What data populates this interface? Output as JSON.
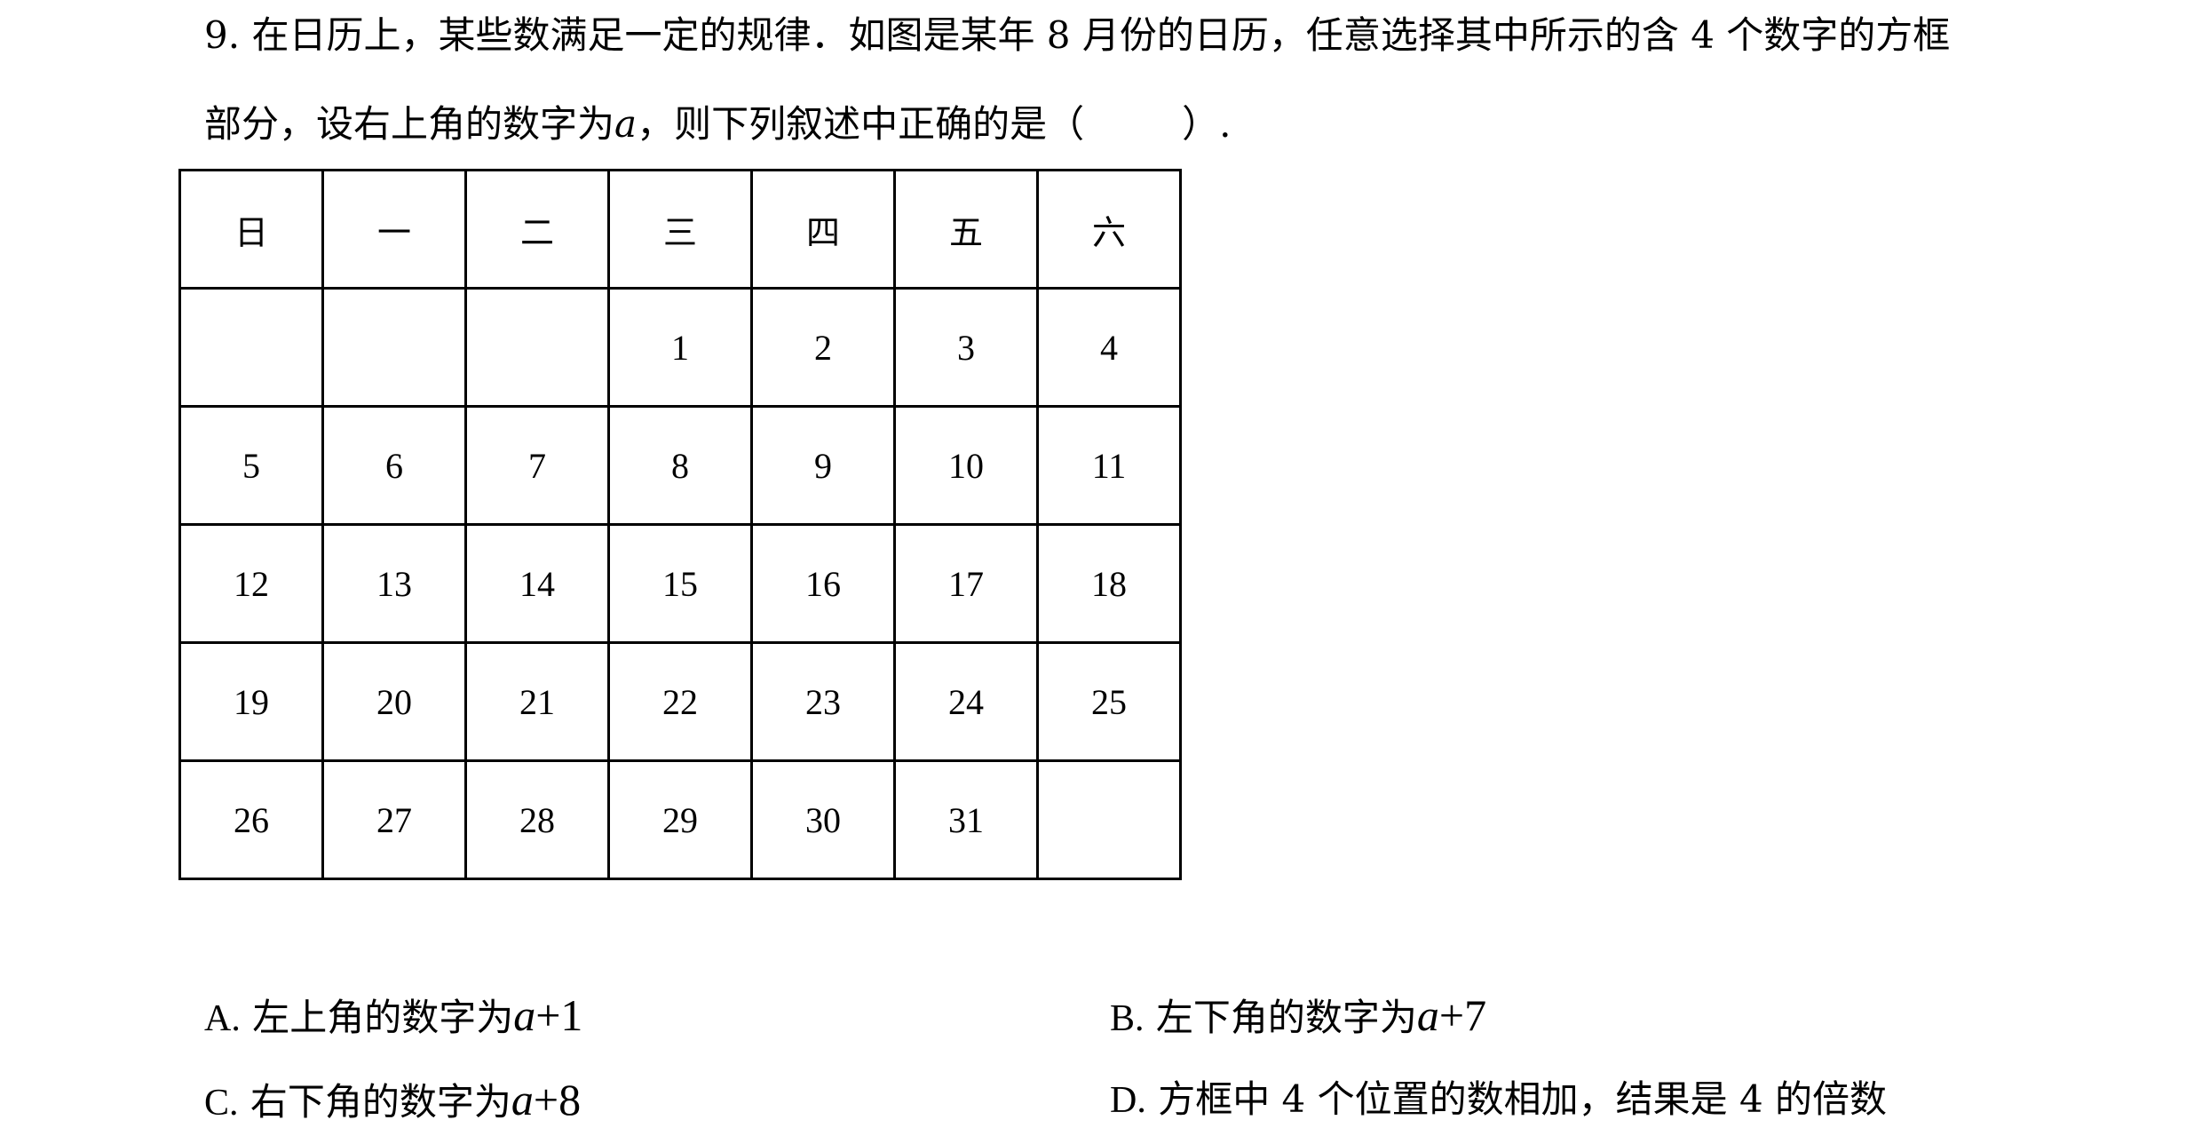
{
  "question": {
    "number": "9.",
    "line1": "在日历上，某些数满足一定的规律．如图是某年 8 月份的日历，任意选择其中所示的含 4 个数字的方框",
    "line2_before": "部分，设右上角的数字为",
    "var": "a",
    "line2_after": "，则下列叙述中正确的是（",
    "line2_close": "）."
  },
  "calendar": {
    "headers": [
      "日",
      "一",
      "二",
      "三",
      "四",
      "五",
      "六"
    ],
    "rows": [
      [
        "",
        "",
        "",
        "1",
        "2",
        "3",
        "4"
      ],
      [
        "5",
        "6",
        "7",
        "8",
        "9",
        "10",
        "11"
      ],
      [
        "12",
        "13",
        "14",
        "15",
        "16",
        "17",
        "18"
      ],
      [
        "19",
        "20",
        "21",
        "22",
        "23",
        "24",
        "25"
      ],
      [
        "26",
        "27",
        "28",
        "29",
        "30",
        "31",
        ""
      ]
    ]
  },
  "options": {
    "A": {
      "letter": "A.",
      "text": "左上角的数字为",
      "math_var": "a",
      "math_rest": "+1"
    },
    "B": {
      "letter": "B.",
      "text": "左下角的数字为",
      "math_var": "a",
      "math_rest": "+7"
    },
    "C": {
      "letter": "C.",
      "text": "右下角的数字为",
      "math_var": "a",
      "math_rest": "+8"
    },
    "D": {
      "letter": "D.",
      "text": "方框中 4 个位置的数相加，结果是 4 的倍数"
    }
  }
}
